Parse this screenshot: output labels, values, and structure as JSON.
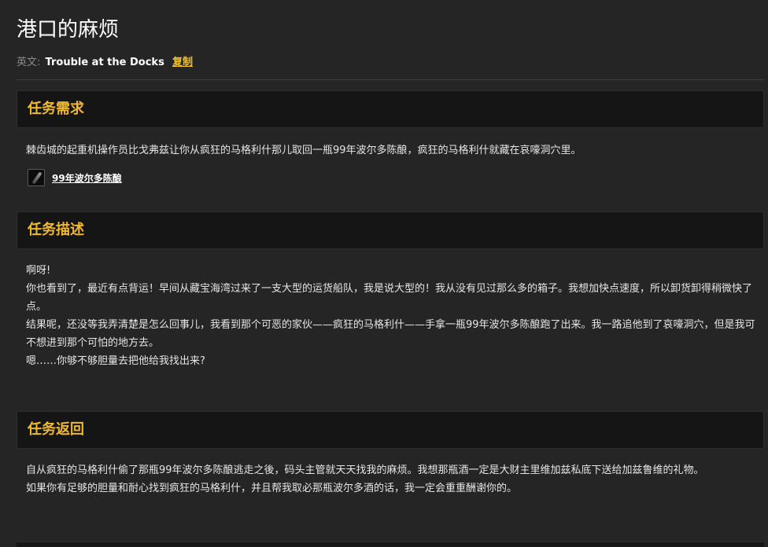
{
  "page": {
    "title": "港口的麻烦",
    "english_label": "英文:",
    "english_name": "Trouble at the Docks",
    "copy_label": "复制"
  },
  "requirements": {
    "header": "任务需求",
    "text": "棘齿城的起重机操作员比戈弗兹让你从疯狂的马格利什那儿取回一瓶99年波尔多陈酿，疯狂的马格利什就藏在哀嚎洞穴里。",
    "item": {
      "icon": "bottle-icon",
      "name": "99年波尔多陈酿"
    }
  },
  "description": {
    "header": "任务描述",
    "lines": [
      "啊呀!",
      "你也看到了，最近有点背运！早间从藏宝海湾过来了一支大型的运货船队，我是说大型的！我从没有见过那么多的箱子。我想加快点速度，所以卸货卸得稍微快了点。",
      "结果呢，还没等我弄清楚是怎么回事儿，我看到那个可恶的家伙——疯狂的马格利什——手拿一瓶99年波尔多陈酿跑了出来。我一路追他到了哀嚎洞穴，但是我可不想进到那个可怕的地方去。",
      "嗯……你够不够胆量去把他给我找出来?"
    ]
  },
  "reward": {
    "header": "任务返回",
    "lines": [
      "自从疯狂的马格利什偷了那瓶99年波尔多陈酿逃走之後，码头主管就天天找我的麻烦。我想那瓶酒一定是大财主里维加兹私底下送给加兹鲁维的礼物。",
      "如果你有足够的胆量和耐心找到疯狂的马格利什，并且帮我取必那瓶波尔多酒的话，我一定会重重酬谢你的。"
    ]
  }
}
